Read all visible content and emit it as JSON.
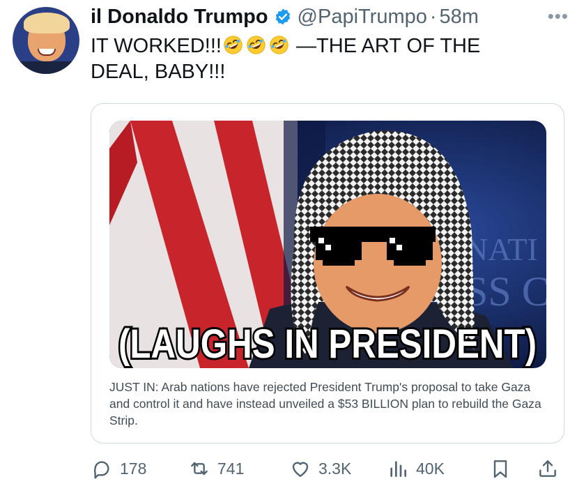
{
  "tweet": {
    "display_name": "il Donaldo Trumpo",
    "handle": "@PapiTrumpo",
    "separator": "·",
    "time": "58m",
    "more_label": "•••",
    "text_part1": "IT WORKED!!!",
    "emoji_names": [
      "rolling-on-floor-laughing-emoji",
      "rolling-on-floor-laughing-emoji",
      "rolling-on-floor-laughing-emoji"
    ],
    "text_part2": " —THE ART OF THE DEAL, BABY!!!"
  },
  "card": {
    "image_caption": "(LAUGHS IN PRESIDENT)",
    "image_sign_text": "NATI SS C",
    "description": "JUST IN: Arab nations have rejected President Trump's proposal to take Gaza and control it and have instead unveiled a $53 BILLION plan to rebuild the Gaza Strip."
  },
  "actions": {
    "replies": "178",
    "reposts": "741",
    "likes": "3.3K",
    "views": "40K"
  },
  "icons": {
    "verified": "verified-badge-icon",
    "reply": "reply-icon",
    "repost": "repost-icon",
    "like": "heart-icon",
    "views": "views-icon",
    "bookmark": "bookmark-icon",
    "share": "share-icon"
  },
  "colors": {
    "verified_blue": "#1d9bf0",
    "text_primary": "#0f1419",
    "text_secondary": "#536471",
    "border": "#cfd9de"
  }
}
